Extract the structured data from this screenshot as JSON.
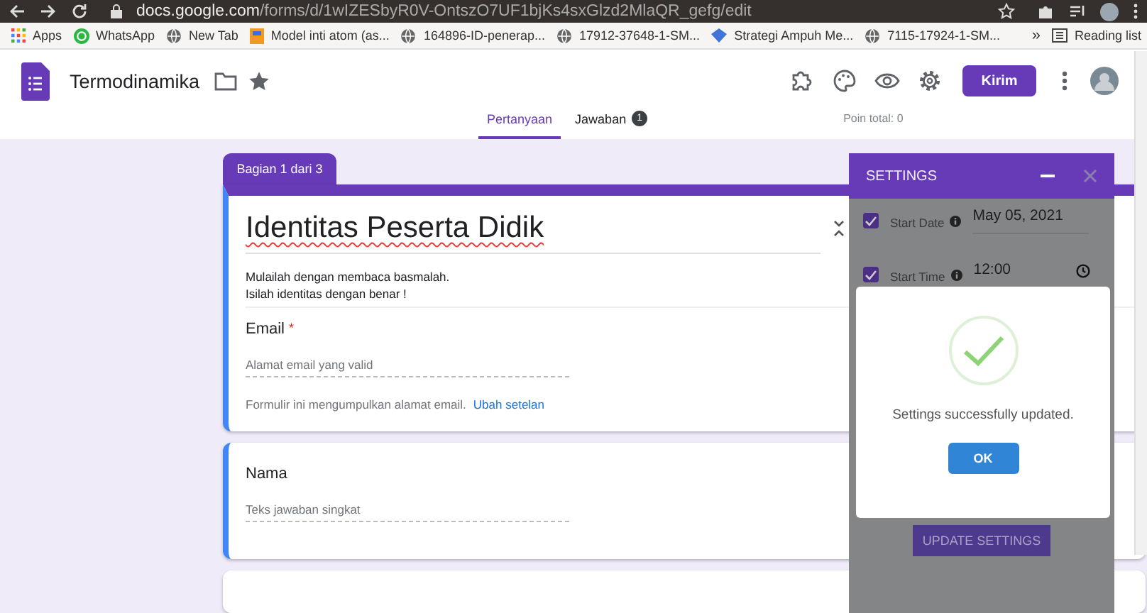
{
  "browser": {
    "url_host": "docs.google.com",
    "url_path": "/forms/d/1wIZESbyR0V-OntszO7UF1bjKs4sxGlzd2MlaQR_gefg/edit",
    "bookmarks": [
      {
        "label": "Apps",
        "kind": "apps"
      },
      {
        "label": "WhatsApp",
        "kind": "whatsapp"
      },
      {
        "label": "New Tab",
        "kind": "globe"
      },
      {
        "label": "Model inti atom (as...",
        "kind": "doc"
      },
      {
        "label": "164896-ID-penerap...",
        "kind": "globe"
      },
      {
        "label": "17912-37648-1-SM...",
        "kind": "globe"
      },
      {
        "label": "Strategi Ampuh Me...",
        "kind": "diamond"
      },
      {
        "label": "7115-17924-1-SM...",
        "kind": "globe"
      }
    ],
    "more": "»",
    "reading_list": "Reading list"
  },
  "app": {
    "title": "Termodinamika",
    "send_button": "Kirim",
    "tabs": [
      {
        "label": "Pertanyaan",
        "selected": true
      },
      {
        "label": "Jawaban",
        "selected": false,
        "badge": "1"
      }
    ],
    "points": "Poin total: 0"
  },
  "section_tab": "Bagian 1 dari 3",
  "form_header": {
    "title": "Identitas Peserta Didik",
    "description": [
      "Mulailah dengan membaca basmalah.",
      "Isilah identitas dengan benar !"
    ]
  },
  "questions": [
    {
      "label": "Email",
      "required_mark": "*",
      "placeholder": "Alamat email yang valid",
      "note": "Formulir ini mengumpulkan alamat email.",
      "note_link": "Ubah setelan"
    },
    {
      "label": "Nama",
      "placeholder": "Teks jawaban singkat"
    }
  ],
  "settings": {
    "title": "SETTINGS",
    "rows": [
      {
        "label": "Start Date",
        "checked": true,
        "value": "May 05, 2021",
        "kind": "date"
      },
      {
        "label": "Start Time",
        "checked": true,
        "value": "12:00",
        "kind": "time"
      }
    ],
    "update_button": "UPDATE SETTINGS"
  },
  "dialog": {
    "message": "Settings successfully updated.",
    "ok": "OK"
  }
}
